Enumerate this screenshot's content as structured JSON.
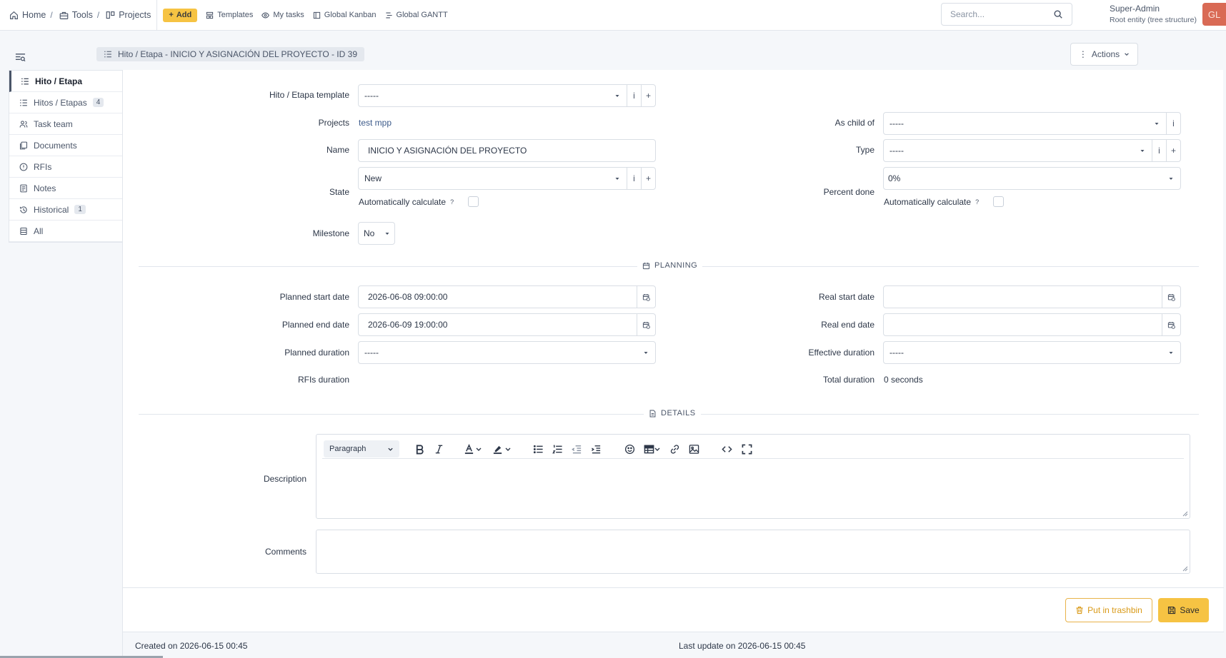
{
  "breadcrumb": {
    "home": "Home",
    "tools": "Tools",
    "projects": "Projects",
    "separator": "/"
  },
  "topnav": {
    "add": "Add",
    "templates": "Templates",
    "my_tasks": "My tasks",
    "global_kanban": "Global Kanban",
    "global_gantt": "Global GANTT"
  },
  "search": {
    "placeholder": "Search..."
  },
  "user": {
    "name": "Super-Admin",
    "entity": "Root entity (tree structure)",
    "initials": "GL"
  },
  "page": {
    "title": "Hito / Etapa -  INICIO Y ASIGNACIÓN DEL PROYECTO - ID 39",
    "actions": "Actions"
  },
  "tabs": [
    {
      "label": "Hito / Etapa",
      "badge": ""
    },
    {
      "label": "Hitos / Etapas",
      "badge": "4"
    },
    {
      "label": "Task team",
      "badge": ""
    },
    {
      "label": "Documents",
      "badge": ""
    },
    {
      "label": "RFIs",
      "badge": ""
    },
    {
      "label": "Notes",
      "badge": ""
    },
    {
      "label": "Historical",
      "badge": "1"
    },
    {
      "label": "All",
      "badge": ""
    }
  ],
  "form": {
    "template_label": "Hito / Etapa template",
    "template_value": "-----",
    "projects_label": "Projects",
    "projects_value": "test mpp",
    "child_label": "As child of",
    "child_value": "-----",
    "name_label": "Name",
    "name_value": "INICIO Y ASIGNACIÓN DEL PROYECTO",
    "type_label": "Type",
    "type_value": "-----",
    "state_label": "State",
    "state_value": "New",
    "percent_label": "Percent done",
    "percent_value": "0%",
    "auto_calc": "Automatically calculate",
    "help": "?",
    "milestone_label": "Milestone",
    "milestone_value": "No",
    "info": "i",
    "plus": "+"
  },
  "planning": {
    "section": "PLANNING",
    "planned_start_label": "Planned start date",
    "planned_start_value": "2026-06-08 09:00:00",
    "real_start_label": "Real start date",
    "real_start_value": "",
    "planned_end_label": "Planned end date",
    "planned_end_value": "2026-06-09 19:00:00",
    "real_end_label": "Real end date",
    "real_end_value": "",
    "planned_duration_label": "Planned duration",
    "planned_duration_value": "-----",
    "effective_duration_label": "Effective duration",
    "effective_duration_value": "-----",
    "rfis_duration_label": "RFIs duration",
    "total_duration_label": "Total duration",
    "total_duration_value": "0 seconds"
  },
  "details": {
    "section": "DETAILS",
    "description_label": "Description",
    "paragraph": "Paragraph",
    "comments_label": "Comments"
  },
  "buttons": {
    "trash": "Put in trashbin",
    "save": "Save"
  },
  "meta": {
    "created": "Created on 2026-06-15 00:45",
    "updated": "Last update on 2026-06-15 00:45"
  },
  "colors": {
    "accent": "#f6c343",
    "avatar": "#d96a55"
  }
}
